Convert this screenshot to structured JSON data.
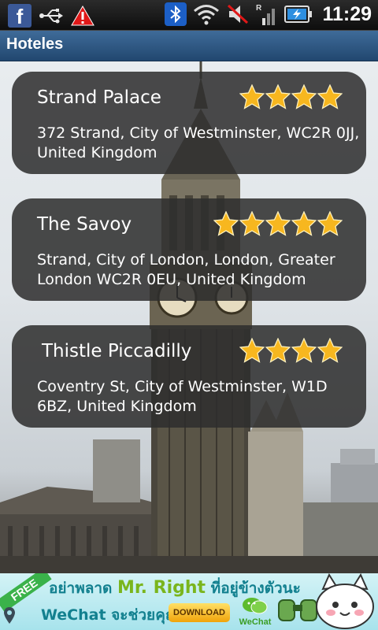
{
  "status_bar": {
    "time": "11:29",
    "icons": [
      "facebook-icon",
      "usb-icon",
      "warning-icon",
      "bluetooth-icon",
      "wifi-icon",
      "mute-icon",
      "signal-icon",
      "battery-icon"
    ]
  },
  "title_bar": {
    "title": "Hoteles"
  },
  "hotels": [
    {
      "name": "Strand Palace",
      "address": "372 Strand, City of Westminster, WC2R 0JJ, United Kingdom",
      "stars": 4
    },
    {
      "name": "The Savoy",
      "address": "Strand, City of London, London, Greater London WC2R 0EU, United Kingdom",
      "stars": 5
    },
    {
      "name": "Thistle Piccadilly",
      "address": "Coventry St, City of Westminster, W1D 6BZ, United Kingdom",
      "stars": 4
    }
  ],
  "ad": {
    "badge": "FREE",
    "line1_prefix": "อย่าพลาด",
    "line1_brand": "Mr. Right",
    "line1_suffix": "ที่อยู่ข้างตัวนะ",
    "line2": "WeChat จะช่วยคุณ",
    "download_label": "DOWNLOAD",
    "app_name": "WeChat"
  },
  "colors": {
    "title_bar": "#2f5a86",
    "card_bg": "#2d2d2d",
    "star": "#f7b71f",
    "bluetooth": "#1c5fc6",
    "facebook": "#3b5998"
  }
}
